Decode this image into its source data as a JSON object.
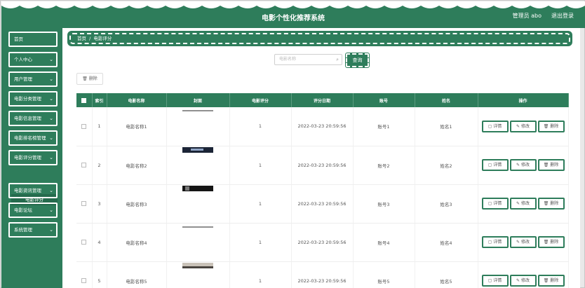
{
  "header": {
    "title": "电影个性化推荐系统",
    "admin": "管理员 abo",
    "logout": "退出登录"
  },
  "sidebar": {
    "items": [
      {
        "label": "首页",
        "has_chevron": false
      },
      {
        "label": "个人中心",
        "has_chevron": true
      },
      {
        "label": "用户管理",
        "has_chevron": true
      },
      {
        "label": "电影分类管理",
        "has_chevron": true
      },
      {
        "label": "电影信息管理",
        "has_chevron": true
      },
      {
        "label": "电影排名榜管理",
        "has_chevron": true
      },
      {
        "label": "电影评分管理",
        "has_chevron": true
      },
      {
        "label": "电影资讯管理",
        "has_chevron": true
      },
      {
        "label": "电影论坛",
        "has_chevron": true
      },
      {
        "label": "系统管理",
        "has_chevron": true
      }
    ],
    "submenu": "电影评分"
  },
  "breadcrumb": [
    "首页",
    "/",
    "电影评分"
  ],
  "search": {
    "placeholder": "电影名称",
    "button": "查询"
  },
  "toolbar": {
    "delete": "删除"
  },
  "table": {
    "headers": [
      "",
      "索引",
      "电影名称",
      "封面",
      "电影评分",
      "评分日期",
      "账号",
      "姓名",
      "操作"
    ],
    "rows": [
      {
        "index": "1",
        "name": "电影名称1",
        "score": "1",
        "date": "2022-03-23 20:59:56",
        "account": "账号1",
        "person": "姓名1"
      },
      {
        "index": "2",
        "name": "电影名称2",
        "score": "1",
        "date": "2022-03-23 20:59:56",
        "account": "账号2",
        "person": "姓名2"
      },
      {
        "index": "3",
        "name": "电影名称3",
        "score": "1",
        "date": "2022-03-23 20:59:56",
        "account": "账号3",
        "person": "姓名3"
      },
      {
        "index": "4",
        "name": "电影名称4",
        "score": "1",
        "date": "2022-03-23 20:59:56",
        "account": "账号4",
        "person": "姓名4"
      },
      {
        "index": "5",
        "name": "电影名称5",
        "score": "1",
        "date": "2022-03-23 20:59:56",
        "account": "账号5",
        "person": "姓名5"
      }
    ],
    "actions": {
      "detail": "详情",
      "edit": "修改",
      "delete": "删除"
    }
  },
  "colors": {
    "accent": "#2e7d5b"
  }
}
